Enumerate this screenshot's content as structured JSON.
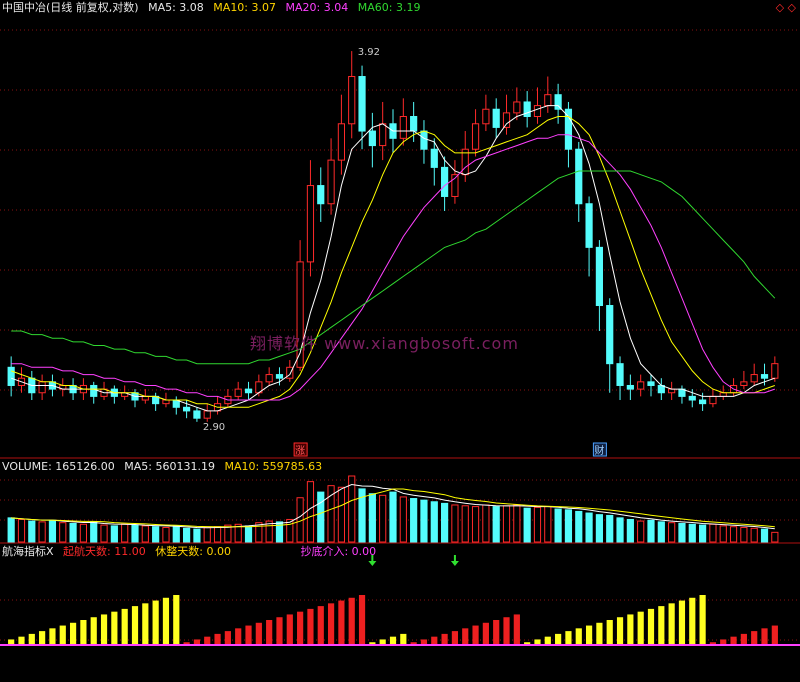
{
  "header": {
    "title": "中国中冶(日线 前复权,对数)",
    "ma5": "MA5: 3.08",
    "ma10": "MA10: 3.07",
    "ma20": "MA20: 3.04",
    "ma60": "MA60: 3.19",
    "corner_icons": "◇ ◇"
  },
  "volume_header": {
    "volume": "VOLUME: 165126.00",
    "ma5": "MA5: 560131.19",
    "ma10": "MA10: 559785.63"
  },
  "indicator_header": {
    "name": "航海指标X",
    "qihang": "起航天数: 11.00",
    "xiuzheng": "休整天数: 0.00",
    "chaodi": "抄底介入: 0.00"
  },
  "watermark": "翔博软件 www.xiangbosoft.com",
  "colors": {
    "up": "#ff2a2a",
    "down": "#54fcfc",
    "ma5": "#ffffff",
    "ma10": "#ffff00",
    "ma20": "#ff40ff",
    "ma60": "#30d830"
  },
  "chart_data": [
    {
      "type": "candlestick",
      "name": "price",
      "annotations": {
        "high_label": "3.92",
        "low_label": "2.90",
        "event_1": "涨",
        "event_2": "财"
      },
      "ylim": [
        2.85,
        4.0
      ],
      "bars": [
        [
          3.05,
          3.0,
          3.08,
          2.97
        ],
        [
          3.0,
          3.02,
          3.05,
          2.98
        ],
        [
          3.02,
          2.98,
          3.04,
          2.96
        ],
        [
          2.98,
          3.01,
          3.03,
          2.96
        ],
        [
          3.01,
          2.99,
          3.03,
          2.97
        ],
        [
          2.99,
          3.0,
          3.02,
          2.97
        ],
        [
          3.0,
          2.98,
          3.02,
          2.96
        ],
        [
          2.98,
          3.0,
          3.02,
          2.96
        ],
        [
          3.0,
          2.97,
          3.01,
          2.95
        ],
        [
          2.97,
          2.99,
          3.01,
          2.96
        ],
        [
          2.99,
          2.97,
          3.0,
          2.95
        ],
        [
          2.97,
          2.98,
          3.0,
          2.96
        ],
        [
          2.98,
          2.96,
          2.99,
          2.94
        ],
        [
          2.96,
          2.97,
          2.99,
          2.95
        ],
        [
          2.97,
          2.95,
          2.98,
          2.93
        ],
        [
          2.95,
          2.96,
          2.98,
          2.94
        ],
        [
          2.96,
          2.94,
          2.97,
          2.92
        ],
        [
          2.94,
          2.93,
          2.96,
          2.91
        ],
        [
          2.93,
          2.91,
          2.94,
          2.9
        ],
        [
          2.91,
          2.93,
          2.95,
          2.9
        ],
        [
          2.93,
          2.95,
          2.97,
          2.92
        ],
        [
          2.95,
          2.97,
          2.99,
          2.94
        ],
        [
          2.97,
          2.99,
          3.01,
          2.96
        ],
        [
          2.99,
          2.98,
          3.01,
          2.96
        ],
        [
          2.98,
          3.01,
          3.03,
          2.97
        ],
        [
          3.01,
          3.03,
          3.05,
          3.0
        ],
        [
          3.03,
          3.02,
          3.05,
          3.0
        ],
        [
          3.02,
          3.05,
          3.07,
          3.01
        ],
        [
          3.05,
          3.34,
          3.4,
          3.04
        ],
        [
          3.34,
          3.55,
          3.62,
          3.3
        ],
        [
          3.55,
          3.5,
          3.6,
          3.45
        ],
        [
          3.5,
          3.62,
          3.68,
          3.47
        ],
        [
          3.62,
          3.72,
          3.8,
          3.58
        ],
        [
          3.72,
          3.85,
          3.92,
          3.68
        ],
        [
          3.85,
          3.7,
          3.88,
          3.65
        ],
        [
          3.7,
          3.66,
          3.75,
          3.6
        ],
        [
          3.66,
          3.72,
          3.78,
          3.62
        ],
        [
          3.72,
          3.68,
          3.76,
          3.64
        ],
        [
          3.68,
          3.74,
          3.79,
          3.66
        ],
        [
          3.74,
          3.7,
          3.78,
          3.67
        ],
        [
          3.7,
          3.65,
          3.73,
          3.61
        ],
        [
          3.65,
          3.6,
          3.68,
          3.55
        ],
        [
          3.6,
          3.52,
          3.63,
          3.48
        ],
        [
          3.52,
          3.58,
          3.62,
          3.5
        ],
        [
          3.58,
          3.65,
          3.7,
          3.56
        ],
        [
          3.65,
          3.72,
          3.76,
          3.63
        ],
        [
          3.72,
          3.76,
          3.8,
          3.7
        ],
        [
          3.76,
          3.71,
          3.79,
          3.68
        ],
        [
          3.71,
          3.75,
          3.8,
          3.69
        ],
        [
          3.75,
          3.78,
          3.82,
          3.73
        ],
        [
          3.78,
          3.74,
          3.81,
          3.71
        ],
        [
          3.74,
          3.77,
          3.82,
          3.72
        ],
        [
          3.77,
          3.8,
          3.85,
          3.75
        ],
        [
          3.8,
          3.76,
          3.83,
          3.72
        ],
        [
          3.76,
          3.65,
          3.78,
          3.6
        ],
        [
          3.65,
          3.5,
          3.67,
          3.45
        ],
        [
          3.5,
          3.38,
          3.52,
          3.3
        ],
        [
          3.38,
          3.22,
          3.4,
          3.15
        ],
        [
          3.22,
          3.06,
          3.24,
          2.98
        ],
        [
          3.06,
          3.0,
          3.08,
          2.96
        ],
        [
          3.0,
          2.99,
          3.03,
          2.96
        ],
        [
          2.99,
          3.01,
          3.03,
          2.97
        ],
        [
          3.01,
          3.0,
          3.03,
          2.97
        ],
        [
          3.0,
          2.98,
          3.02,
          2.96
        ],
        [
          2.98,
          2.99,
          3.01,
          2.96
        ],
        [
          2.99,
          2.97,
          3.0,
          2.95
        ],
        [
          2.97,
          2.96,
          2.99,
          2.94
        ],
        [
          2.96,
          2.95,
          2.98,
          2.93
        ],
        [
          2.95,
          2.97,
          2.99,
          2.94
        ],
        [
          2.97,
          2.98,
          3.0,
          2.96
        ],
        [
          2.98,
          3.0,
          3.02,
          2.97
        ],
        [
          3.0,
          3.01,
          3.04,
          2.99
        ],
        [
          3.01,
          3.03,
          3.06,
          3.0
        ],
        [
          3.03,
          3.02,
          3.06,
          3.0
        ],
        [
          3.02,
          3.06,
          3.08,
          3.01
        ]
      ]
    },
    {
      "type": "line",
      "name": "MA5",
      "color": "#ffffff",
      "values": [
        3.02,
        3.01,
        3.0,
        3.0,
        3.0,
        2.99,
        2.99,
        2.99,
        2.99,
        2.98,
        2.98,
        2.98,
        2.97,
        2.97,
        2.97,
        2.96,
        2.96,
        2.95,
        2.94,
        2.93,
        2.93,
        2.94,
        2.95,
        2.96,
        2.98,
        3.0,
        3.01,
        3.03,
        3.09,
        3.2,
        3.29,
        3.41,
        3.55,
        3.65,
        3.68,
        3.71,
        3.72,
        3.7,
        3.7,
        3.7,
        3.68,
        3.67,
        3.62,
        3.59,
        3.58,
        3.59,
        3.63,
        3.68,
        3.72,
        3.74,
        3.75,
        3.76,
        3.77,
        3.77,
        3.74,
        3.69,
        3.61,
        3.5,
        3.36,
        3.23,
        3.13,
        3.06,
        3.03,
        3.0,
        2.99,
        2.99,
        2.98,
        2.97,
        2.97,
        2.97,
        2.97,
        2.98,
        3.0,
        3.01,
        3.02
      ]
    },
    {
      "type": "line",
      "name": "MA10",
      "color": "#ffff00",
      "values": [
        3.04,
        3.03,
        3.02,
        3.01,
        3.01,
        3.0,
        3.0,
        2.99,
        2.99,
        2.99,
        2.98,
        2.98,
        2.98,
        2.97,
        2.97,
        2.96,
        2.96,
        2.96,
        2.95,
        2.95,
        2.94,
        2.94,
        2.94,
        2.94,
        2.95,
        2.96,
        2.97,
        2.99,
        3.03,
        3.09,
        3.16,
        3.23,
        3.31,
        3.38,
        3.45,
        3.51,
        3.58,
        3.64,
        3.67,
        3.69,
        3.7,
        3.69,
        3.66,
        3.64,
        3.64,
        3.64,
        3.65,
        3.66,
        3.67,
        3.68,
        3.69,
        3.71,
        3.73,
        3.74,
        3.74,
        3.72,
        3.69,
        3.63,
        3.56,
        3.48,
        3.4,
        3.32,
        3.25,
        3.18,
        3.12,
        3.08,
        3.04,
        3.01,
        2.99,
        2.98,
        2.98,
        2.98,
        2.98,
        2.99,
        3.0
      ]
    },
    {
      "type": "line",
      "name": "MA20",
      "color": "#ff40ff",
      "values": [
        3.06,
        3.06,
        3.05,
        3.05,
        3.05,
        3.04,
        3.04,
        3.03,
        3.03,
        3.02,
        3.02,
        3.01,
        3.01,
        3.0,
        3.0,
        2.99,
        2.99,
        2.98,
        2.98,
        2.97,
        2.97,
        2.96,
        2.96,
        2.96,
        2.96,
        2.96,
        2.96,
        2.97,
        2.99,
        3.02,
        3.05,
        3.09,
        3.13,
        3.17,
        3.21,
        3.26,
        3.31,
        3.36,
        3.41,
        3.45,
        3.49,
        3.52,
        3.55,
        3.57,
        3.6,
        3.62,
        3.63,
        3.64,
        3.65,
        3.66,
        3.67,
        3.68,
        3.68,
        3.69,
        3.69,
        3.68,
        3.67,
        3.64,
        3.61,
        3.58,
        3.54,
        3.49,
        3.44,
        3.38,
        3.31,
        3.24,
        3.17,
        3.1,
        3.05,
        3.01,
        2.99,
        2.98,
        2.98,
        2.98,
        2.99
      ]
    },
    {
      "type": "line",
      "name": "MA60",
      "color": "#30d830",
      "values": [
        3.15,
        3.15,
        3.14,
        3.14,
        3.13,
        3.13,
        3.12,
        3.12,
        3.11,
        3.11,
        3.1,
        3.1,
        3.09,
        3.09,
        3.08,
        3.08,
        3.07,
        3.07,
        3.06,
        3.06,
        3.06,
        3.06,
        3.06,
        3.06,
        3.07,
        3.07,
        3.08,
        3.09,
        3.1,
        3.12,
        3.14,
        3.16,
        3.18,
        3.2,
        3.22,
        3.24,
        3.26,
        3.28,
        3.3,
        3.32,
        3.34,
        3.36,
        3.38,
        3.39,
        3.4,
        3.42,
        3.43,
        3.45,
        3.47,
        3.49,
        3.51,
        3.53,
        3.55,
        3.57,
        3.58,
        3.59,
        3.59,
        3.59,
        3.59,
        3.59,
        3.59,
        3.58,
        3.57,
        3.56,
        3.54,
        3.52,
        3.49,
        3.46,
        3.43,
        3.4,
        3.37,
        3.34,
        3.3,
        3.27,
        3.24
      ]
    },
    {
      "type": "bar",
      "name": "volume",
      "values": [
        30,
        28,
        26,
        25,
        27,
        24,
        23,
        22,
        25,
        21,
        20,
        22,
        21,
        20,
        19,
        18,
        20,
        17,
        16,
        18,
        19,
        21,
        22,
        20,
        24,
        26,
        25,
        28,
        55,
        75,
        62,
        70,
        68,
        82,
        66,
        60,
        58,
        62,
        56,
        54,
        52,
        50,
        48,
        46,
        45,
        44,
        46,
        44,
        45,
        46,
        42,
        43,
        44,
        41,
        40,
        38,
        36,
        34,
        33,
        30,
        28,
        26,
        27,
        25,
        24,
        23,
        22,
        21,
        22,
        20,
        19,
        18,
        17,
        16,
        12
      ]
    },
    {
      "type": "bar",
      "name": "indicator",
      "values": [
        2,
        3,
        4,
        5,
        6,
        7,
        8,
        9,
        10,
        11,
        12,
        13,
        14,
        15,
        16,
        17,
        18,
        1,
        2,
        3,
        4,
        5,
        6,
        7,
        8,
        9,
        10,
        11,
        12,
        13,
        14,
        15,
        16,
        17,
        18,
        1,
        2,
        3,
        4,
        1,
        2,
        3,
        4,
        5,
        6,
        7,
        8,
        9,
        10,
        11,
        1,
        2,
        3,
        4,
        5,
        6,
        7,
        8,
        9,
        10,
        11,
        12,
        13,
        14,
        15,
        16,
        17,
        18,
        1,
        2,
        3,
        4,
        5,
        6,
        7
      ]
    }
  ]
}
